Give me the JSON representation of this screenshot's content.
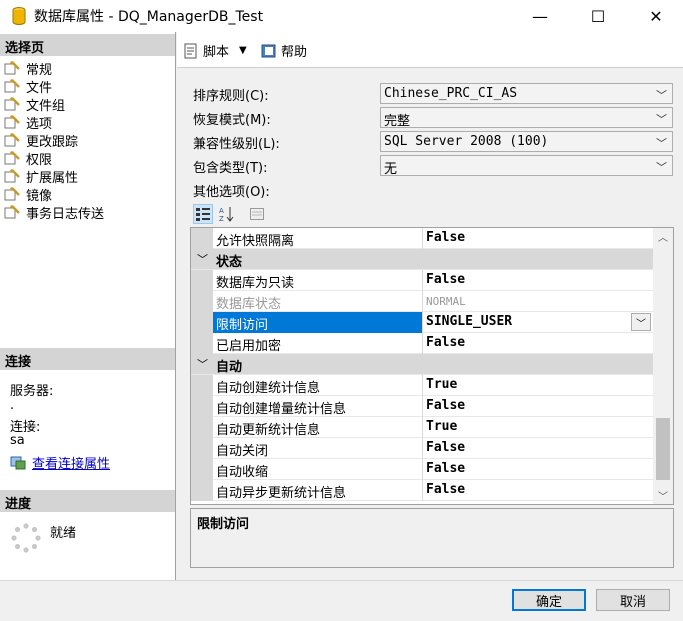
{
  "window": {
    "title": "数据库属性 - DQ_ManagerDB_Test",
    "minimize": "—",
    "maximize": "☐",
    "close": "✕"
  },
  "left": {
    "select_page_header": "选择页",
    "pages": [
      {
        "label": "常规"
      },
      {
        "label": "文件"
      },
      {
        "label": "文件组"
      },
      {
        "label": "选项"
      },
      {
        "label": "更改跟踪"
      },
      {
        "label": "权限"
      },
      {
        "label": "扩展属性"
      },
      {
        "label": "镜像"
      },
      {
        "label": "事务日志传送"
      }
    ],
    "connection_header": "连接",
    "server_label": "服务器:",
    "server_value": ".",
    "connection_label": "连接:",
    "connection_value": "sa",
    "view_conn_props": "查看连接属性",
    "progress_header": "进度",
    "progress_status": "就绪"
  },
  "toolbar": {
    "script_label": "脚本",
    "script_dropdown": "▼",
    "help_label": "帮助"
  },
  "form": {
    "collation_label": "排序规则(C):",
    "collation_value": "Chinese_PRC_CI_AS",
    "recovery_label": "恢复模式(M):",
    "recovery_value": "完整",
    "compat_label": "兼容性级别(L):",
    "compat_value": "SQL Server 2008 (100)",
    "containment_label": "包含类型(T):",
    "containment_value": "无",
    "other_options_label": "其他选项(O):"
  },
  "grid": {
    "rows": [
      {
        "name": "允许快照隔离",
        "value": "False"
      },
      {
        "name": "状态",
        "category": true
      },
      {
        "name": "数据库为只读",
        "value": "False"
      },
      {
        "name": "数据库状态",
        "value": "NORMAL",
        "disabled": true
      },
      {
        "name": "限制访问",
        "value": "SINGLE_USER",
        "selected": true
      },
      {
        "name": "已启用加密",
        "value": "False"
      },
      {
        "name": "自动",
        "category": true
      },
      {
        "name": "自动创建统计信息",
        "value": "True"
      },
      {
        "name": "自动创建增量统计信息",
        "value": "False"
      },
      {
        "name": "自动更新统计信息",
        "value": "True"
      },
      {
        "name": "自动关闭",
        "value": "False"
      },
      {
        "name": "自动收缩",
        "value": "False"
      },
      {
        "name": "自动异步更新统计信息",
        "value": "False"
      }
    ],
    "description_title": "限制访问"
  },
  "buttons": {
    "ok": "确定",
    "cancel": "取消"
  },
  "colors": {
    "selection": "#0078d7",
    "link": "#0000cc",
    "category_bg": "#d8d8d8"
  }
}
